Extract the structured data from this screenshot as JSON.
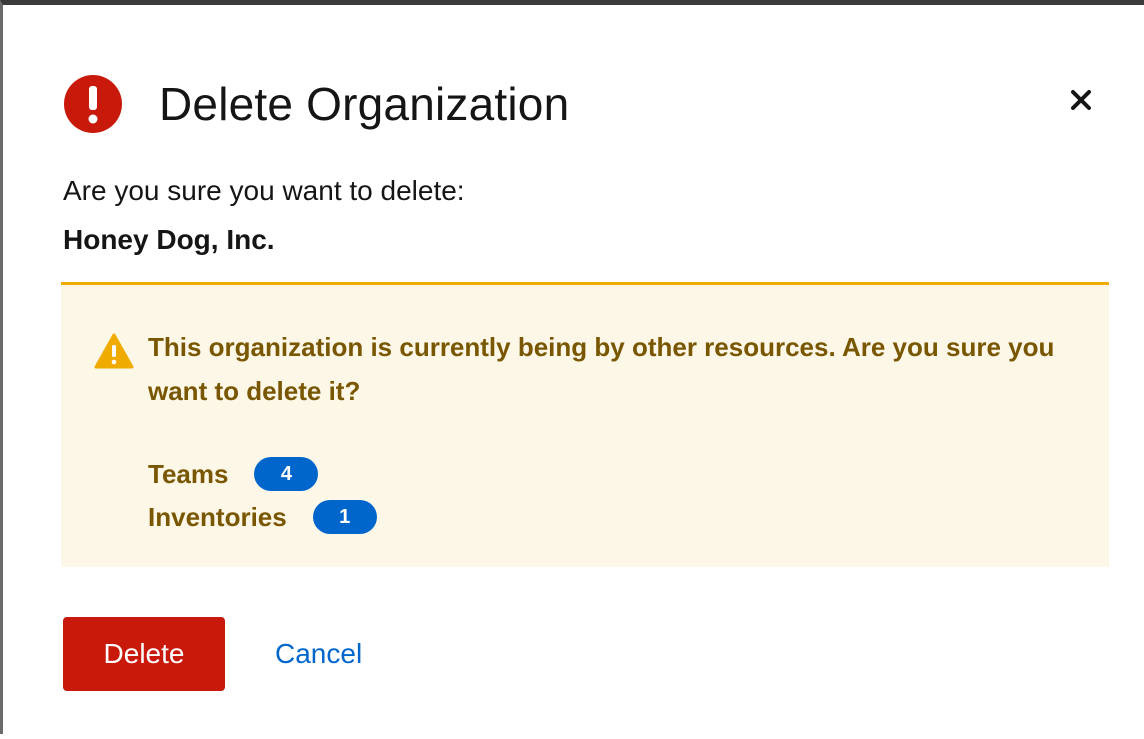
{
  "modal": {
    "title": "Delete Organization",
    "title_icon": "exclamation-circle-icon",
    "close_icon": "close-icon",
    "confirm_text": "Are you sure you want to delete:",
    "item_name": "Honey Dog, Inc."
  },
  "warning": {
    "icon": "warning-triangle-icon",
    "message": "This organization is currently being by other resources. Are you sure you want to delete it?",
    "resources": [
      {
        "label": "Teams",
        "count": "4"
      },
      {
        "label": "Inventories",
        "count": "1"
      }
    ]
  },
  "actions": {
    "delete_label": "Delete",
    "cancel_label": "Cancel"
  },
  "colors": {
    "danger": "#c9190b",
    "warning_accent": "#f0ab00",
    "warning_bg": "#fdf7e7",
    "warning_text": "#795600",
    "link": "#0066cc",
    "badge": "#0066cc"
  }
}
